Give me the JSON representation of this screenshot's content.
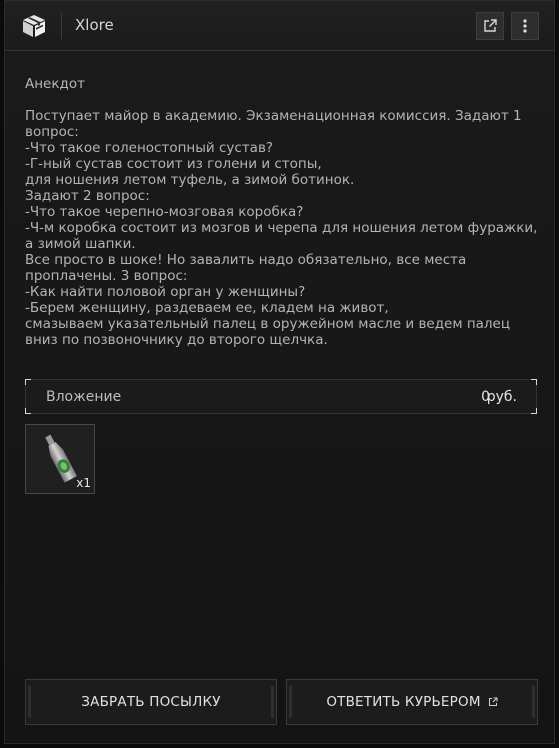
{
  "titlebar": {
    "title": "Xlore",
    "app_icon": "package-box-icon",
    "external_icon": "external-link-icon",
    "menu_icon": "vertical-dots-icon"
  },
  "message": {
    "subject": "Анекдот",
    "lines": [
      "Поступает майор в академию. Экзаменационная комиссия. Задают 1",
      "вопрос:",
      "-Что такое голеностопный сустав?",
      "-Г-ный сустав состоит из голени и стопы,",
      "для ношения летом туфель, а зимой ботинок.",
      "Задают 2 вопрос:",
      "-Что такое черепно-мозговая коробка?",
      "-Ч-м коробка состоит из мозгов и черепа для ношения летом фуражки,",
      "а зимой шапки.",
      "Все просто в шоке! Но завалить надо обязательно, все места",
      "проплачены. 3 вопрос:",
      "-Как найти половой орган у женщины?",
      "-Берем женщину, раздеваем ее, кладем на живот,",
      "смазываем указательный палец в оружейном масле и ведем палец",
      "вниз по позвоночнику до второго щелчка."
    ]
  },
  "attachment": {
    "label": "Вложение",
    "amount": "0",
    "currency": "руб.",
    "item": {
      "icon": "bottle-item-icon",
      "count": "x1"
    }
  },
  "actions": {
    "collect_label": "ЗАБРАТЬ ПОСЫЛКУ",
    "reply_label": "ОТВЕТИТЬ КУРЬЕРОМ",
    "reply_icon": "external-link-icon"
  }
}
